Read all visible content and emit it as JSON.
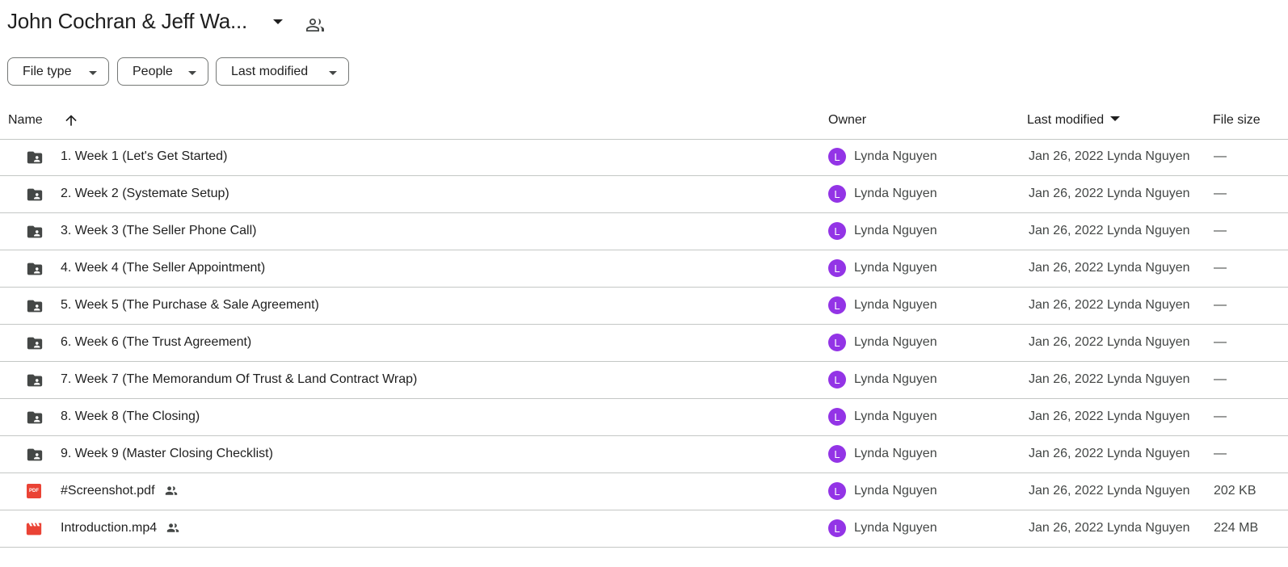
{
  "header": {
    "title": "John Cochran & Jeff Wa..."
  },
  "filters": [
    {
      "label": "File type"
    },
    {
      "label": "People"
    },
    {
      "label": "Last modified"
    }
  ],
  "table": {
    "columns": {
      "name": "Name",
      "owner": "Owner",
      "last_modified": "Last modified",
      "file_size": "File size"
    },
    "rows": [
      {
        "icon": "shared-folder-icon",
        "name": "1. Week 1 (Let's Get Started)",
        "shared": false,
        "avatar": "L",
        "owner": "Lynda Nguyen",
        "modified": "Jan 26, 2022 Lynda Nguyen",
        "size": "—"
      },
      {
        "icon": "shared-folder-icon",
        "name": "2. Week 2 (Systemate Setup)",
        "shared": false,
        "avatar": "L",
        "owner": "Lynda Nguyen",
        "modified": "Jan 26, 2022 Lynda Nguyen",
        "size": "—"
      },
      {
        "icon": "shared-folder-icon",
        "name": "3. Week 3 (The Seller Phone Call)",
        "shared": false,
        "avatar": "L",
        "owner": "Lynda Nguyen",
        "modified": "Jan 26, 2022 Lynda Nguyen",
        "size": "—"
      },
      {
        "icon": "shared-folder-icon",
        "name": "4. Week 4 (The Seller Appointment)",
        "shared": false,
        "avatar": "L",
        "owner": "Lynda Nguyen",
        "modified": "Jan 26, 2022 Lynda Nguyen",
        "size": "—"
      },
      {
        "icon": "shared-folder-icon",
        "name": "5. Week 5 (The Purchase & Sale Agreement)",
        "shared": false,
        "avatar": "L",
        "owner": "Lynda Nguyen",
        "modified": "Jan 26, 2022 Lynda Nguyen",
        "size": "—"
      },
      {
        "icon": "shared-folder-icon",
        "name": "6. Week 6 (The Trust Agreement)",
        "shared": false,
        "avatar": "L",
        "owner": "Lynda Nguyen",
        "modified": "Jan 26, 2022 Lynda Nguyen",
        "size": "—"
      },
      {
        "icon": "shared-folder-icon",
        "name": "7. Week 7 (The Memorandum Of Trust & Land Contract Wrap)",
        "shared": false,
        "avatar": "L",
        "owner": "Lynda Nguyen",
        "modified": "Jan 26, 2022 Lynda Nguyen",
        "size": "—"
      },
      {
        "icon": "shared-folder-icon",
        "name": "8. Week 8 (The Closing)",
        "shared": false,
        "avatar": "L",
        "owner": "Lynda Nguyen",
        "modified": "Jan 26, 2022 Lynda Nguyen",
        "size": "—"
      },
      {
        "icon": "shared-folder-icon",
        "name": "9. Week 9 (Master Closing Checklist)",
        "shared": false,
        "avatar": "L",
        "owner": "Lynda Nguyen",
        "modified": "Jan 26, 2022 Lynda Nguyen",
        "size": "—"
      },
      {
        "icon": "pdf-icon",
        "icon_text": "PDF",
        "name": "#Screenshot.pdf",
        "shared": true,
        "avatar": "L",
        "owner": "Lynda Nguyen",
        "modified": "Jan 26, 2022 Lynda Nguyen",
        "size": "202 KB"
      },
      {
        "icon": "video-icon",
        "name": "Introduction.mp4",
        "shared": true,
        "avatar": "L",
        "owner": "Lynda Nguyen",
        "modified": "Jan 26, 2022 Lynda Nguyen",
        "size": "224 MB"
      }
    ]
  },
  "colors": {
    "avatar": "#9334e6",
    "folder": "#444746",
    "pdf": "#ea4335",
    "video": "#ea4335",
    "divider": "#c4c7c5"
  }
}
